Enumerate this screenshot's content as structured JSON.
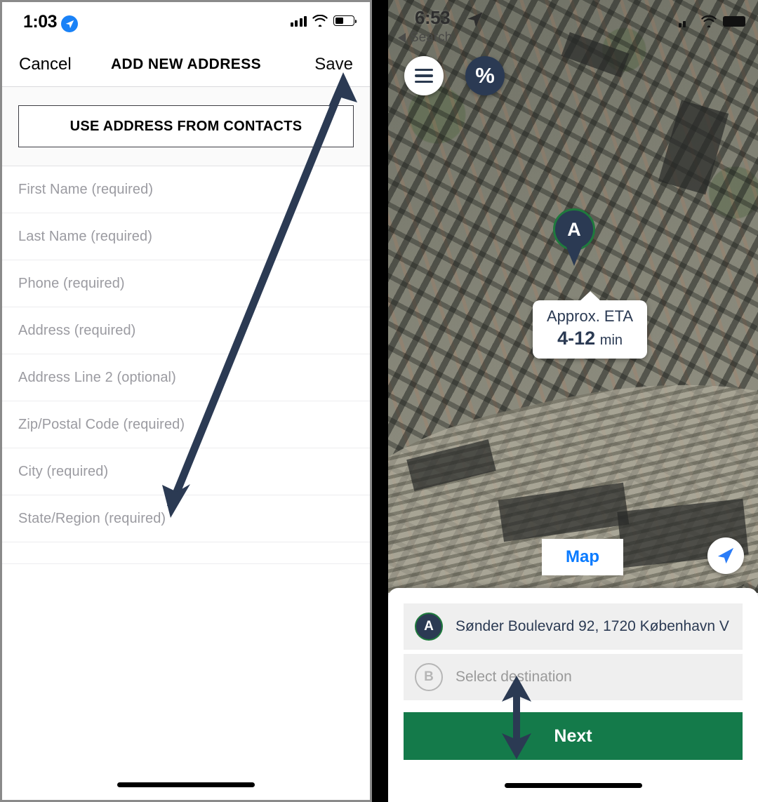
{
  "left_screen": {
    "status_bar": {
      "time": "1:03",
      "location_icon": "location-arrow-icon",
      "signal_icon": "cellular-bars-icon",
      "wifi_icon": "wifi-icon",
      "battery_icon": "battery-icon",
      "battery_level_pct": 45
    },
    "nav_bar": {
      "cancel_label": "Cancel",
      "title": "ADD NEW ADDRESS",
      "save_label": "Save"
    },
    "contacts_button_label": "USE ADDRESS FROM CONTACTS",
    "form_fields": [
      {
        "placeholder": "First Name (required)",
        "value": ""
      },
      {
        "placeholder": "Last Name (required)",
        "value": ""
      },
      {
        "placeholder": "Phone (required)",
        "value": ""
      },
      {
        "placeholder": "Address (required)",
        "value": ""
      },
      {
        "placeholder": "Address Line 2 (optional)",
        "value": ""
      },
      {
        "placeholder": "Zip/Postal Code (required)",
        "value": ""
      },
      {
        "placeholder": "City (required)",
        "value": ""
      },
      {
        "placeholder": "State/Region (required)",
        "value": ""
      }
    ]
  },
  "right_screen": {
    "status_bar": {
      "time": "6:53",
      "location_icon": "location-arrow-icon",
      "back_label": "Search",
      "back_icon": "back-triangle-icon",
      "signal_icon": "cellular-bars-icon",
      "wifi_icon": "wifi-icon",
      "battery_icon": "battery-icon"
    },
    "map_controls": {
      "menu_icon": "hamburger-menu-icon",
      "promo_label": "%",
      "map_button_label": "Map",
      "locate_icon": "location-arrow-icon"
    },
    "pin": {
      "label": "A"
    },
    "eta_callout": {
      "label": "Approx. ETA",
      "range": "4-12",
      "unit": "min"
    },
    "bottom_sheet": {
      "pickup": {
        "badge": "A",
        "text": "Sønder Boulevard 92, 1720 København V"
      },
      "destination": {
        "badge": "B",
        "placeholder": "Select destination"
      },
      "next_label": "Next"
    }
  },
  "colors": {
    "navy": "#2b3a53",
    "green": "#147a4a",
    "pin_ring_green": "#1f7a3d",
    "blue_link": "#0a7bff",
    "placeholder_gray": "#9b9ba1",
    "row_gray": "#efefef"
  },
  "annotations": {
    "arrow_to_save": "arrow-pointing-to-save-button",
    "arrow_destination_next": "double-headed-arrow-destination-to-next"
  }
}
